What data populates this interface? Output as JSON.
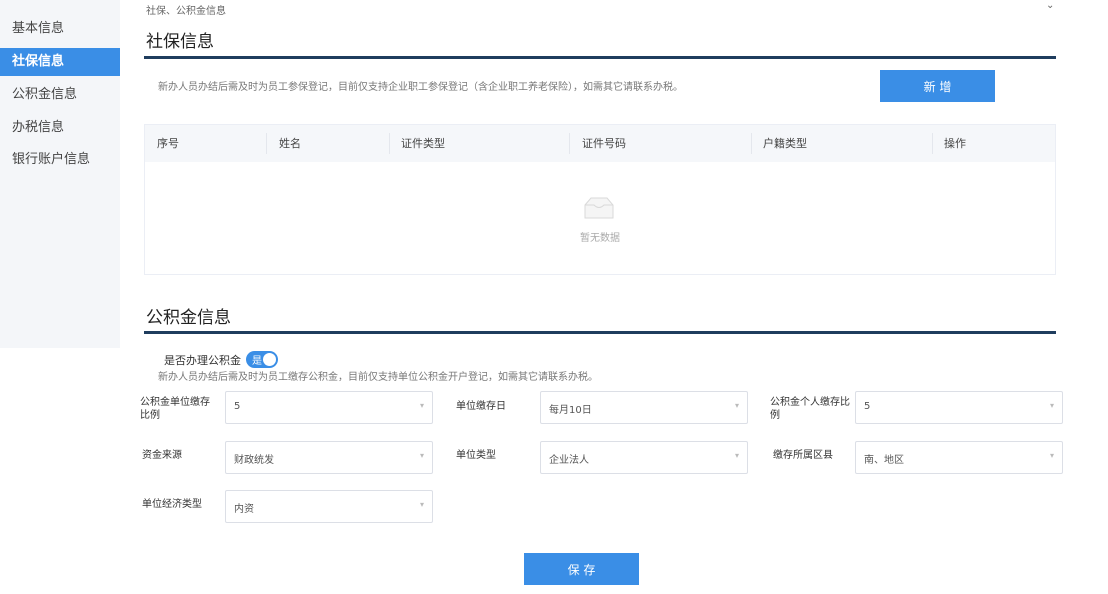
{
  "sidebar": {
    "items": [
      {
        "label": "基本信息"
      },
      {
        "label": "社保信息"
      },
      {
        "label": "公积金信息"
      },
      {
        "label": "办税信息"
      },
      {
        "label": "银行账户信息"
      }
    ]
  },
  "top": {
    "crumb": "社保、公积金信息"
  },
  "social": {
    "title": "社保信息",
    "hint": "新办人员办结后需及时为员工参保登记，目前仅支持企业职工参保登记（含企业职工养老保险），如需其它请联系办税。",
    "add_label": "新 增",
    "columns": [
      "序号",
      "姓名",
      "证件类型",
      "证件号码",
      "户籍类型",
      "操作"
    ],
    "empty_text": "暂无数据"
  },
  "fund": {
    "title": "公积金信息",
    "switch_label": "是否办理公积金",
    "switch_text": "是",
    "hint": "新办人员办结后需及时为员工缴存公积金，目前仅支持单位公积金开户登记，如需其它请联系办税。",
    "fields": {
      "unit_ratio": {
        "label": "公积金单位缴存比例",
        "value": "5"
      },
      "pay_day": {
        "label": "单位缴存日",
        "value": "每月10日"
      },
      "personal_ratio": {
        "label": "公积金个人缴存比例",
        "value": "5"
      },
      "fund_source": {
        "label": "资金来源",
        "value": "财政统发"
      },
      "unit_type": {
        "label": "单位类型",
        "value": "企业法人"
      },
      "region": {
        "label": "缴存所属区县",
        "value": "南、地区"
      },
      "economy_type": {
        "label": "单位经济类型",
        "value": "内资"
      }
    },
    "save_label": "保 存"
  },
  "colors": {
    "accent": "#3a8ee6",
    "rule": "#1f3d5e",
    "sidebar_bg": "#f4f6f9"
  }
}
